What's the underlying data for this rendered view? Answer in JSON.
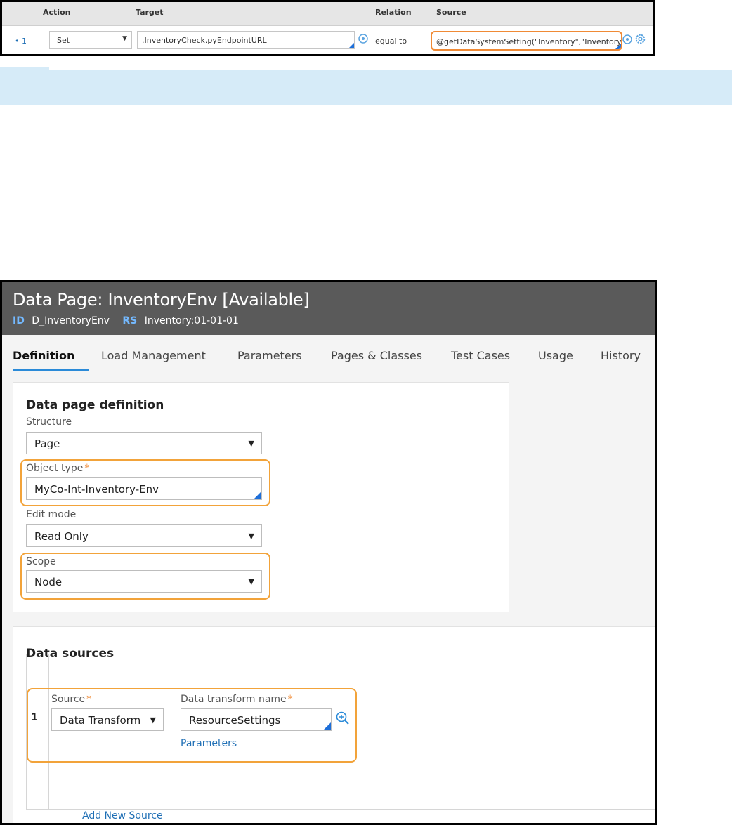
{
  "data_transform": {
    "headers": {
      "action": "Action",
      "target": "Target",
      "relation": "Relation",
      "source": "Source"
    },
    "row": {
      "number": "1",
      "action": "Set",
      "target": ".InventoryCheck.pyEndpointURL",
      "relation": "equal to",
      "source": "@getDataSystemSetting(\"Inventory\",\"Inventory"
    }
  },
  "rule": {
    "title": "Data Page: InventoryEnv [Available]",
    "id_key": "ID",
    "id_value": "D_InventoryEnv",
    "rs_key": "RS",
    "rs_value": "Inventory:01-01-01",
    "tabs": [
      "Definition",
      "Load Management",
      "Parameters",
      "Pages & Classes",
      "Test Cases",
      "Usage",
      "History"
    ],
    "active_tab": "Definition"
  },
  "definition": {
    "title": "Data page definition",
    "structure_label": "Structure",
    "structure_value": "Page",
    "object_type_label": "Object type",
    "object_type_value": "MyCo-Int-Inventory-Env",
    "edit_mode_label": "Edit mode",
    "edit_mode_value": "Read Only",
    "scope_label": "Scope",
    "scope_value": "Node",
    "required_mark": "*"
  },
  "data_sources": {
    "title": "Data sources",
    "row_number": "1",
    "source_label": "Source",
    "source_value": "Data Transform",
    "dt_name_label": "Data transform name",
    "dt_name_value": "ResourceSettings",
    "parameters_link": "Parameters",
    "add_source_link": "Add New Source"
  },
  "colors": {
    "header_bg": "#5a5a5a",
    "highlight": "#f2a33a",
    "link": "#1f6fb5",
    "tab_underline": "#2a8ad8",
    "band": "#d6ebf8"
  }
}
